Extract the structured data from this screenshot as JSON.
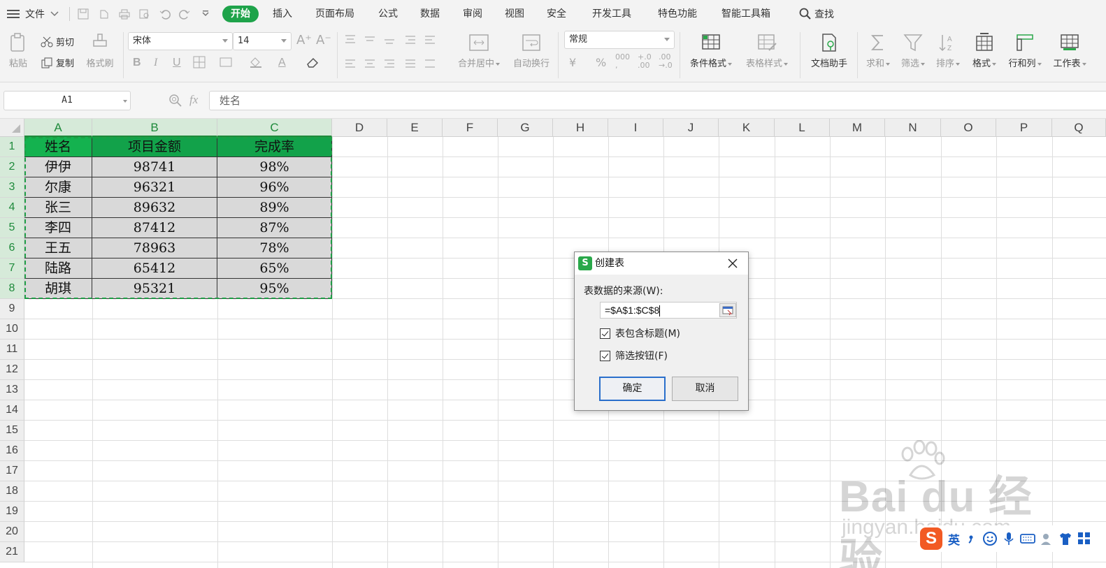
{
  "menubar": {
    "file_label": "文件",
    "tabs": [
      "开始",
      "插入",
      "页面布局",
      "公式",
      "数据",
      "审阅",
      "视图",
      "安全",
      "开发工具",
      "特色功能",
      "智能工具箱"
    ],
    "active_tab": "开始",
    "search_label": "查找"
  },
  "ribbon": {
    "paste_label": "粘贴",
    "cut_label": "剪切",
    "copy_label": "复制",
    "format_painter_label": "格式刷",
    "font_name": "宋体",
    "font_size": "14",
    "merge_center_label": "合并居中",
    "wrap_text_label": "自动换行",
    "number_format": "常规",
    "conditional_format_label": "条件格式",
    "table_style_label": "表格样式",
    "doc_assistant_label": "文档助手",
    "sum_label": "求和",
    "filter_label": "筛选",
    "sort_label": "排序",
    "format_label": "格式",
    "row_col_label": "行和列",
    "worksheet_label": "工作表"
  },
  "formula_bar": {
    "name_box": "A1",
    "fx_label": "fx",
    "formula_value": "姓名"
  },
  "sheet": {
    "columns": [
      "A",
      "B",
      "C",
      "D",
      "E",
      "F",
      "G",
      "H",
      "I",
      "J",
      "K",
      "L",
      "M",
      "N",
      "O",
      "P",
      "Q"
    ],
    "rows": [
      "1",
      "2",
      "3",
      "4",
      "5",
      "6",
      "7",
      "8",
      "9",
      "10",
      "11",
      "12",
      "13",
      "14",
      "15",
      "16",
      "17",
      "18",
      "19",
      "20",
      "21"
    ],
    "table": [
      [
        "姓名",
        "项目金额",
        "完成率"
      ],
      [
        "伊伊",
        "98741",
        "98%"
      ],
      [
        "尔康",
        "96321",
        "96%"
      ],
      [
        "张三",
        "89632",
        "89%"
      ],
      [
        "李四",
        "87412",
        "87%"
      ],
      [
        "王五",
        "78963",
        "78%"
      ],
      [
        "陆路",
        "65412",
        "65%"
      ],
      [
        "胡琪",
        "95321",
        "95%"
      ]
    ]
  },
  "dialog": {
    "title": "创建表",
    "source_label": "表数据的来源(W):",
    "source_value": "=$A$1:$C$8",
    "has_header_label": "表包含标题(M)",
    "has_header_checked": true,
    "filter_button_label": "筛选按钮(F)",
    "filter_button_checked": true,
    "ok_label": "确定",
    "cancel_label": "取消"
  },
  "watermark": {
    "brand": "Bai du 经验",
    "url": "jingyan.baidu.com"
  },
  "ime": {
    "logo": "S",
    "lang": "英"
  },
  "colors": {
    "accent": "#1ea34a",
    "header_fill": "#12a24a",
    "cell_fill": "#d9d9d9",
    "selection_border": "#1e9e45",
    "dialog_primary_border": "#2a6fcb"
  }
}
